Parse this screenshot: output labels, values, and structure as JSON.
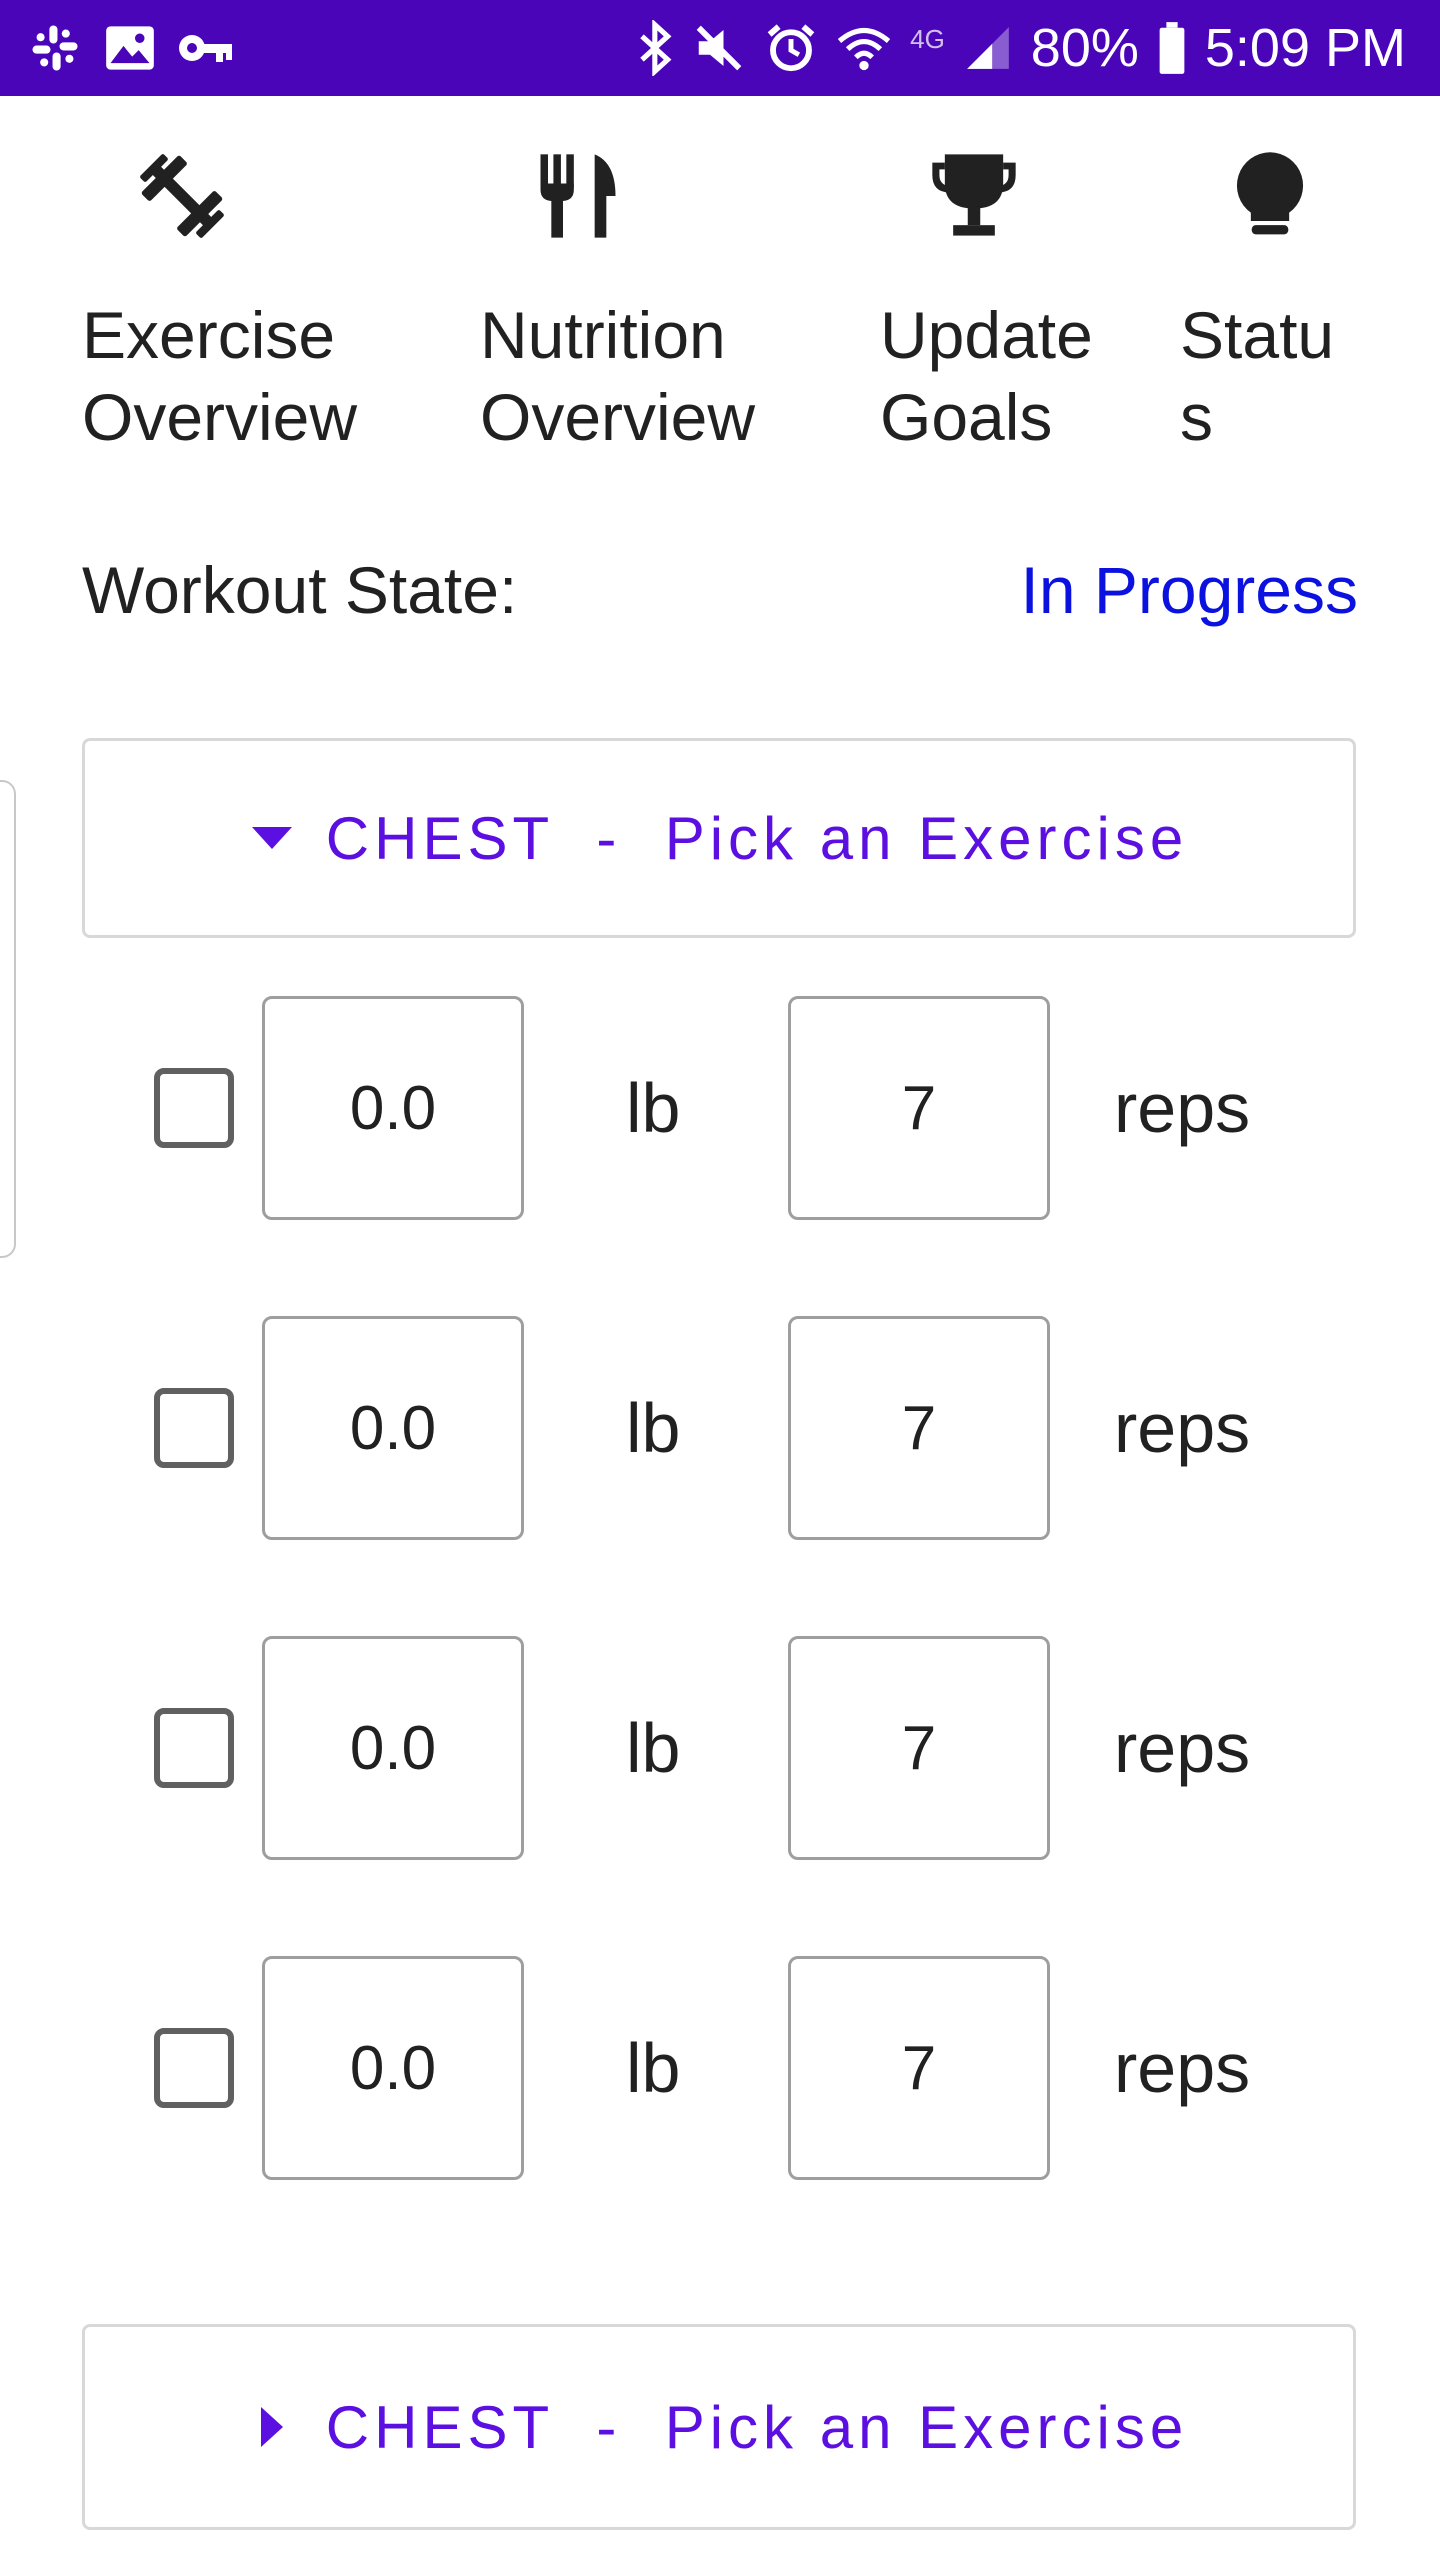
{
  "status_bar": {
    "left_icons": [
      "slack-icon",
      "image-icon",
      "key-icon"
    ],
    "right_icons": [
      "bluetooth-icon",
      "mute-icon",
      "alarm-icon",
      "wifi-icon",
      "lte-icon",
      "signal-icon",
      "battery-icon"
    ],
    "network": "4G",
    "battery": "80%",
    "time": "5:09 PM"
  },
  "nav": {
    "items": [
      {
        "label": "Exercise\nOverview",
        "icon": "dumbbell-icon"
      },
      {
        "label": "Nutrition\nOverview",
        "icon": "fork-knife-icon"
      },
      {
        "label": "Update\nGoals",
        "icon": "trophy-icon"
      },
      {
        "label": "Statu\ns",
        "icon": "lightbulb-icon"
      }
    ]
  },
  "workout": {
    "label": "Workout State:",
    "value": "In Progress"
  },
  "pickers": [
    {
      "text": "CHEST  -  Pick an Exercise",
      "expanded": true
    },
    {
      "text": "CHEST  -  Pick an Exercise",
      "expanded": false
    }
  ],
  "sets": [
    {
      "weight": "0.0",
      "weight_unit": "lb",
      "reps": "7",
      "reps_unit": "reps",
      "checked": false
    },
    {
      "weight": "0.0",
      "weight_unit": "lb",
      "reps": "7",
      "reps_unit": "reps",
      "checked": false
    },
    {
      "weight": "0.0",
      "weight_unit": "lb",
      "reps": "7",
      "reps_unit": "reps",
      "checked": false
    },
    {
      "weight": "0.0",
      "weight_unit": "lb",
      "reps": "7",
      "reps_unit": "reps",
      "checked": false
    }
  ],
  "colors": {
    "status_bar": "#4a05b8",
    "accent": "#5b0fe0",
    "state_value": "#0b12e0"
  }
}
